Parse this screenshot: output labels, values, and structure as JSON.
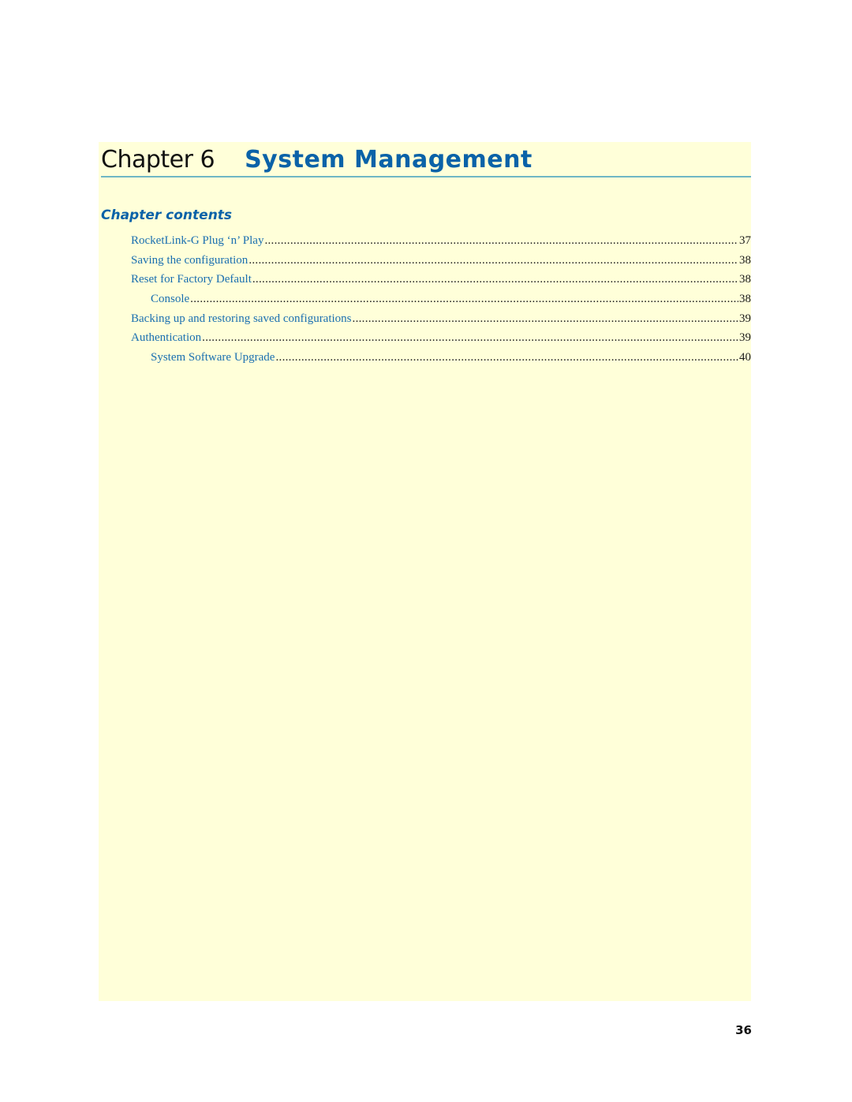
{
  "chapter": {
    "label": "Chapter 6",
    "title": "System Management"
  },
  "contents": {
    "heading": "Chapter contents",
    "entries": [
      {
        "label": "RocketLink-G Plug ‘n’ Play",
        "page": "37",
        "level": 1
      },
      {
        "label": "Saving the configuration",
        "page": "38",
        "level": 1
      },
      {
        "label": "Reset for Factory Default",
        "page": "38",
        "level": 1
      },
      {
        "label": "Console",
        "page": "38",
        "level": 2
      },
      {
        "label": "Backing up and restoring saved configurations",
        "page": "39",
        "level": 1
      },
      {
        "label": "Authentication",
        "page": "39",
        "level": 1
      },
      {
        "label": "System Software Upgrade",
        "page": "40",
        "level": 2
      }
    ]
  },
  "footer": {
    "page_number": "36"
  },
  "colors": {
    "panel_background": "#ffffd9",
    "heading_blue": "#0a62a8",
    "link_blue": "#1a6fb0",
    "rule": "#6fb7c4"
  }
}
